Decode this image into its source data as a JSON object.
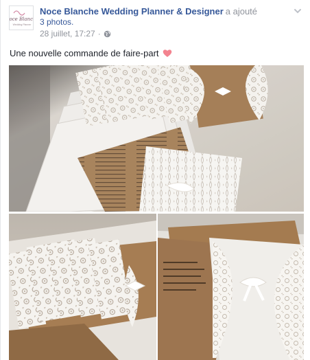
{
  "post": {
    "page_name": "Noce Blanche Wedding Planner & Designer",
    "action_text": "a ajouté",
    "photos_link": "3 photos.",
    "timestamp": "28 juillet, 17:27",
    "separator": "·",
    "privacy_icon": "globe-icon",
    "options_icon": "chevron-down-icon",
    "text": "Une nouvelle commande de faire-part",
    "emoji": "heart-icon",
    "avatar_logo_text": "Noce Blanche",
    "avatar_logo_sub": "Wedding Planner"
  },
  "colors": {
    "link": "#365899",
    "meta": "#90949c",
    "text": "#1d2129",
    "heart": "#f3838f",
    "kraft": "#a9825a",
    "lace": "#f3f1ec",
    "table": "#d8d0c4"
  }
}
